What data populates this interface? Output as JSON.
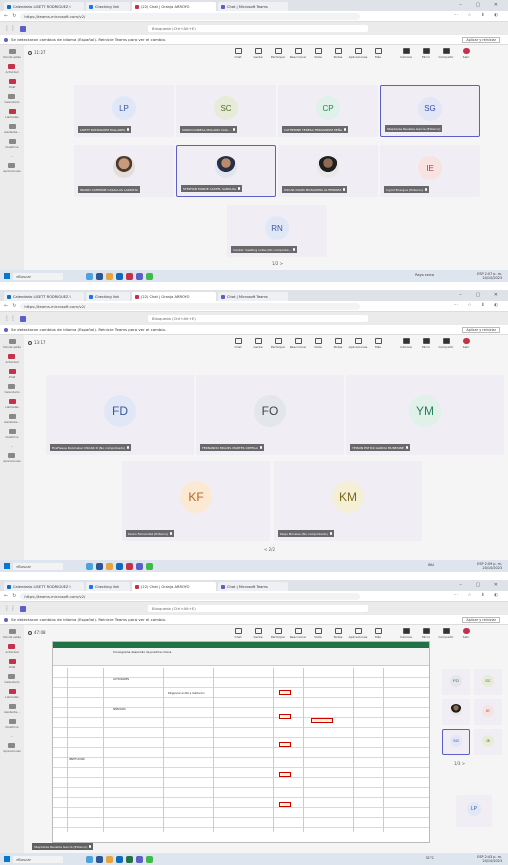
{
  "browser": {
    "tabs": [
      "Calendario LISETT RODRIGUEZ I",
      "Checking link",
      "(22) Chat | Granja ARROYO",
      "Chat | Microsoft Teams"
    ],
    "url": "https://teams.microsoft.com/v2/",
    "search_placeholder": "Búsqueda (Ctrl+Alt+E)"
  },
  "notice": {
    "text": "Se detectaron cambios de idioma (Español). Reinicie Teams para ver el cambio.",
    "button": "Aplicar y reiniciar"
  },
  "rail": [
    {
      "label": "Dónde estás"
    },
    {
      "label": "Actividad"
    },
    {
      "label": "Chat"
    },
    {
      "label": "Calendario"
    },
    {
      "label": "Llamadas"
    },
    {
      "label": "Asistente..."
    },
    {
      "label": "OneDrive"
    },
    {
      "label": "..."
    },
    {
      "label": "Aplicaciones"
    }
  ],
  "controls": [
    "Chat",
    "Gente",
    "Participar",
    "Reaccionar",
    "Vista",
    "Notas",
    "Aplicaciones",
    "Más",
    "Cámara",
    "Micro",
    "Compartir",
    "Salir"
  ],
  "taskbar": {
    "search": "Buscar"
  },
  "screens": [
    {
      "timer": "11:27",
      "pager": "1/2 >",
      "tray": {
        "weather": "Rayo cerca",
        "lang": "ESP",
        "time": "2:07 p. m.",
        "date": "24/10/2023"
      },
      "tiles": [
        {
          "initials": "LP",
          "name": "LISETT RODRIGUEZ PALLARES"
        },
        {
          "initials": "SC",
          "name": "SORIN DANIELA MOLANO CAIA..."
        },
        {
          "initials": "CP",
          "name": "CATHERINE TERESA FERNANDEZ PEÑA"
        },
        {
          "initials": "SG",
          "name": "Stephanie Reusble García (Externo)"
        },
        {
          "initials": "",
          "name": "INGRID CATERINE CASALLAS LARROTA"
        },
        {
          "initials": "",
          "name": "STEPHAN FARIDE CASTEL SARDUAL"
        },
        {
          "initials": "",
          "name": "OSCAR DAVID MOSQUERA GUTIERREZ"
        },
        {
          "initials": "IE",
          "name": "Ingrid Enargue (Externo)"
        },
        {
          "initials": "RN",
          "name": "markar meeting notes (No comproba..."
        }
      ]
    },
    {
      "timer": "13:17",
      "pager": "< 2/2",
      "tray": {
        "weather": "INU",
        "lang": "ESP",
        "time": "2:09 p. m.",
        "date": "24/10/2023"
      },
      "tiles": [
        {
          "initials": "FD",
          "name": "FireFiesue Roomaber OSCAR D (No comprobado)"
        },
        {
          "initials": "FO",
          "name": "FERNANDO MIGUEL MARTES ORTEGA"
        },
        {
          "initials": "YM",
          "name": "YEISON ESTICK GARCIA MUNESINE"
        },
        {
          "initials": "KF",
          "name": "Karen Fernandez (Externo)"
        },
        {
          "initials": "KM",
          "name": "Kelys Morales (No comprobado)"
        }
      ]
    },
    {
      "timer": "47:08",
      "pager": "1/3 >",
      "tray": {
        "weather": "31°C",
        "lang": "ESP",
        "time": "2:43 p. m.",
        "date": "24/10/2023"
      },
      "presenter": "Stephanie Reusble García (Externo)",
      "sheet_title": "Cronograma desarrollo de practica clinica",
      "sheet_labels": [
        "ACTIVIDADES",
        "SERVICIOS",
        "INSTITUCION",
        "Diligenciar en Bio e Institucion"
      ],
      "side_tiles": [
        {
          "initials": "FO"
        },
        {
          "initials": "SC"
        },
        {
          "initials": ""
        },
        {
          "initials": "IE"
        },
        {
          "initials": "SG"
        },
        {
          "initials": "JE"
        },
        {
          "initials": "LP"
        }
      ]
    }
  ],
  "colors": {
    "accent": "#5b5fc7",
    "leave": "#c4314b",
    "excel": "#217346"
  }
}
